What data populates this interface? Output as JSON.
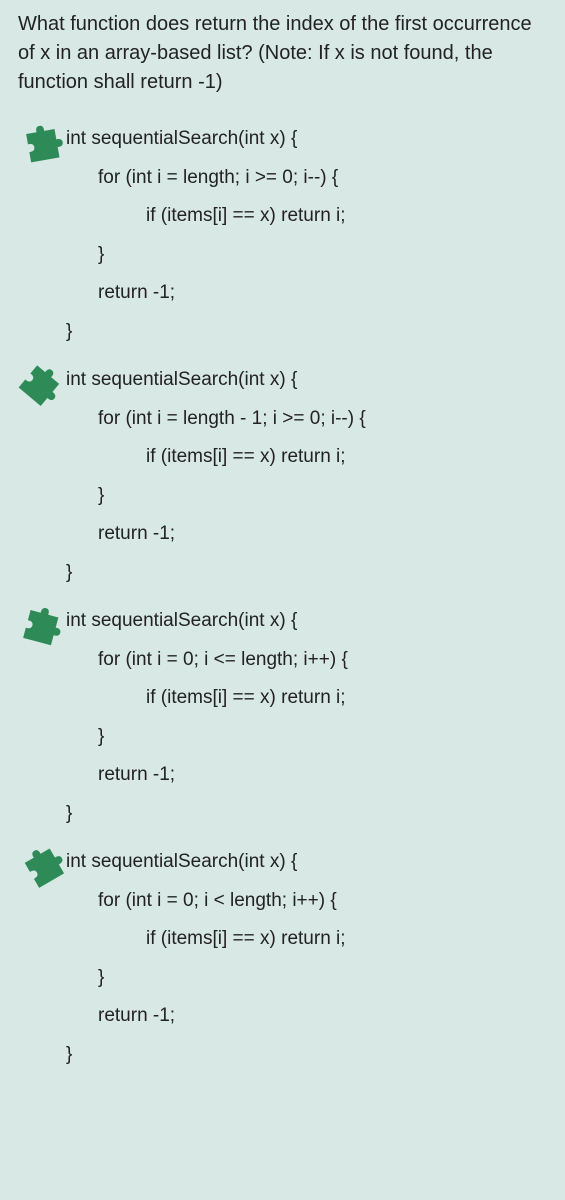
{
  "question": "What function does return the index of the first occurrence of x in an array-based list? (Note: If x is not found, the function shall return -1)",
  "options": [
    {
      "lines": [
        {
          "indent": "",
          "text": "int sequentialSearch(int x) {"
        },
        {
          "indent": "i1",
          "text": "for (int i = length; i >= 0; i--) {"
        },
        {
          "indent": "i2",
          "text": "if (items[i] == x) return i;"
        },
        {
          "indent": "i1",
          "text": "}"
        },
        {
          "indent": "i1",
          "text": "return -1;"
        },
        {
          "indent": "i0",
          "text": "}"
        }
      ]
    },
    {
      "lines": [
        {
          "indent": "",
          "text": "int sequentialSearch(int x) {"
        },
        {
          "indent": "i1",
          "text": "for (int i = length - 1; i >= 0; i--) {"
        },
        {
          "indent": "i2",
          "text": "if (items[i] == x) return i;"
        },
        {
          "indent": "i1",
          "text": "}"
        },
        {
          "indent": "i1",
          "text": "return -1;"
        },
        {
          "indent": "i0",
          "text": "}"
        }
      ]
    },
    {
      "lines": [
        {
          "indent": "",
          "text": "int sequentialSearch(int x) {"
        },
        {
          "indent": "i1",
          "text": "for (int i = 0; i <= length; i++) {"
        },
        {
          "indent": "i2",
          "text": "if (items[i] == x) return i;"
        },
        {
          "indent": "i1",
          "text": "}"
        },
        {
          "indent": "i1",
          "text": "return -1;"
        },
        {
          "indent": "i0",
          "text": "}"
        }
      ]
    },
    {
      "lines": [
        {
          "indent": "",
          "text": "int sequentialSearch(int x) {"
        },
        {
          "indent": "i1",
          "text": "for (int i = 0; i < length; i++) {"
        },
        {
          "indent": "i2",
          "text": "if (items[i] == x) return i;"
        },
        {
          "indent": "i1",
          "text": "}"
        },
        {
          "indent": "i1",
          "text": "return -1;"
        },
        {
          "indent": "i0",
          "text": "}"
        }
      ]
    }
  ],
  "colors": {
    "puzzle": "#2e8b57"
  }
}
